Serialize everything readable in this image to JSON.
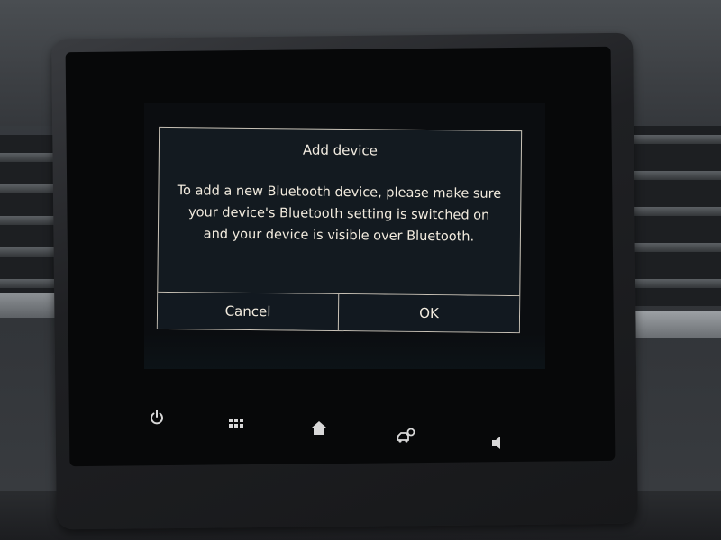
{
  "dialog": {
    "title": "Add device",
    "message": "To add a new Bluetooth device, please make sure your device's Bluetooth setting is switched on and your device is visible over Bluetooth.",
    "cancel_label": "Cancel",
    "ok_label": "OK"
  },
  "hardware_buttons": [
    {
      "icon": "power-icon"
    },
    {
      "icon": "apps-grid-icon"
    },
    {
      "icon": "home-icon"
    },
    {
      "icon": "car-settings-icon"
    },
    {
      "icon": "volume-icon"
    }
  ],
  "colors": {
    "dialog_background": "#131a20",
    "dialog_border": "#c9c2b6",
    "text": "#f3ecdf"
  }
}
